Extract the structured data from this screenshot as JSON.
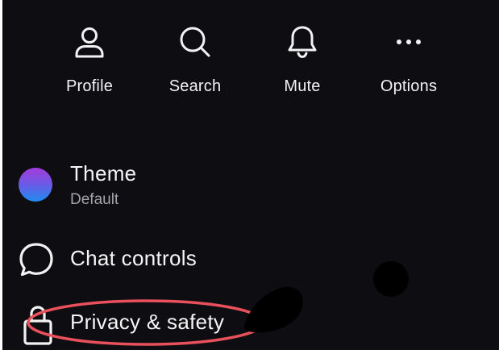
{
  "actions": [
    {
      "label": "Profile",
      "icon": "person-icon"
    },
    {
      "label": "Search",
      "icon": "search-icon"
    },
    {
      "label": "Mute",
      "icon": "bell-icon"
    },
    {
      "label": "Options",
      "icon": "more-horizontal-icon"
    }
  ],
  "settings": {
    "theme": {
      "title": "Theme",
      "subtitle": "Default",
      "colors": [
        "#a33bdb",
        "#1e8df0"
      ]
    },
    "chat_controls": {
      "title": "Chat controls",
      "icon": "speech-bubble-icon"
    },
    "privacy": {
      "title": "Privacy & safety",
      "icon": "lock-icon"
    }
  },
  "annotation": {
    "highlight_color": "#e8505b"
  }
}
